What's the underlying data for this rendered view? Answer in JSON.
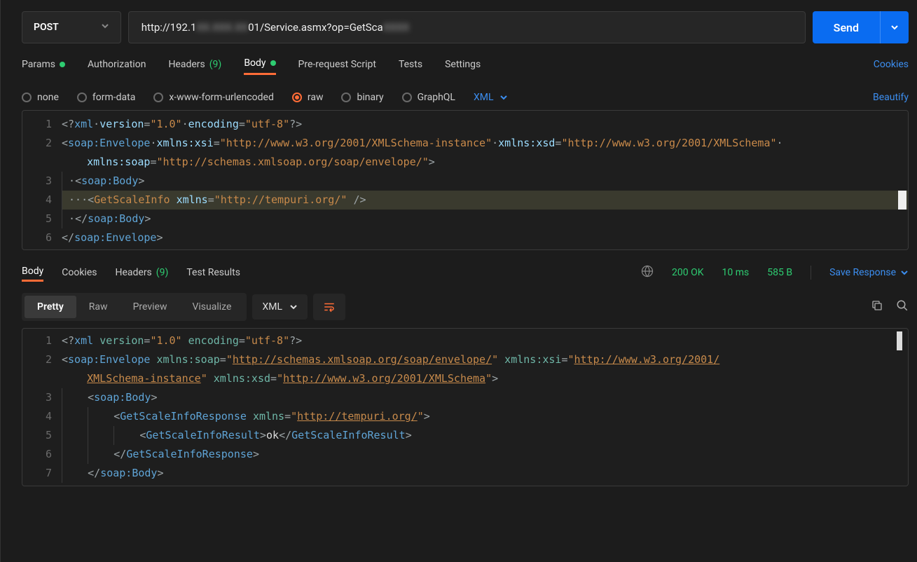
{
  "request": {
    "method": "POST",
    "url_prefix": "http://192.1",
    "url_blur": "XX.XXX.XX",
    "url_mid": "01/Service.asmx?op=GetSca",
    "url_blur2": "XXXX"
  },
  "tabs": {
    "params": "Params",
    "authorization": "Authorization",
    "headers": "Headers",
    "headers_count": "(9)",
    "body": "Body",
    "prerequest": "Pre-request Script",
    "tests": "Tests",
    "settings": "Settings",
    "cookies": "Cookies"
  },
  "body_types": {
    "none": "none",
    "formdata": "form-data",
    "urlencoded": "x-www-form-urlencoded",
    "raw": "raw",
    "binary": "binary",
    "graphql": "GraphQL",
    "format": "XML",
    "beautify": "Beautify"
  },
  "request_code": {
    "l1_a": "<?",
    "l1_b": "xml",
    "l1_c": "version",
    "l1_d": "\"1.0\"",
    "l1_e": "encoding",
    "l1_f": "\"utf-8\"",
    "l1_g": "?>",
    "l2_a": "<",
    "l2_b": "soap:Envelope",
    "l2_c": "xmlns:xsi",
    "l2_d": "\"http://www.w3.org/2001/XMLSchema-instance\"",
    "l2_e": "xmlns:xsd",
    "l2_f": "\"http://www.w3.org/2001/XMLSchema\"",
    "l2w_a": "xmlns:soap",
    "l2w_b": "\"http://schemas.xmlsoap.org/soap/envelope/\"",
    "l2w_c": ">",
    "l3_a": "<",
    "l3_b": "soap:Body",
    "l3_c": ">",
    "l4_a": "<",
    "l4_b": "GetScaleInfo",
    "l4_c": "xmlns",
    "l4_d": "\"http://tempuri.org/\"",
    "l4_e": "/>",
    "l5_a": "</",
    "l5_b": "soap:Body",
    "l5_c": ">",
    "l6_a": "</",
    "l6_b": "soap:Envelope",
    "l6_c": ">"
  },
  "response_tabs": {
    "body": "Body",
    "cookies": "Cookies",
    "headers": "Headers",
    "headers_count": "(9)",
    "testresults": "Test Results"
  },
  "response_meta": {
    "status_code": "200",
    "status_text": "OK",
    "time": "10 ms",
    "size": "585 B",
    "save": "Save Response"
  },
  "view_modes": {
    "pretty": "Pretty",
    "raw": "Raw",
    "preview": "Preview",
    "visualize": "Visualize",
    "format": "XML"
  },
  "response_code": {
    "l1_a": "<?",
    "l1_b": "xml",
    "l1_c": "version",
    "l1_d": "\"1.0\"",
    "l1_e": "encoding",
    "l1_f": "\"utf-8\"",
    "l1_g": "?>",
    "l2_a": "<",
    "l2_b": "soap:Envelope",
    "l2_c": "xmlns:soap",
    "l2_d": "http://schemas.xmlsoap.org/soap/envelope/",
    "l2_e": "xmlns:xsi",
    "l2_f": "http://www.w3.org/2001/",
    "l2w_a": "XMLSchema-instance",
    "l2w_b": "xmlns:xsd",
    "l2w_c": "http://www.w3.org/2001/XMLSchema",
    "l2w_d": ">",
    "l3_a": "<",
    "l3_b": "soap:Body",
    "l3_c": ">",
    "l4_a": "<",
    "l4_b": "GetScaleInfoResponse",
    "l4_c": "xmlns",
    "l4_d": "http://tempuri.org/",
    "l4_e": ">",
    "l5_a": "<",
    "l5_b": "GetScaleInfoResult",
    "l5_c": ">",
    "l5_tx": "ok",
    "l5_d": "</",
    "l5_e": "GetScaleInfoResult",
    "l5_f": ">",
    "l6_a": "</",
    "l6_b": "GetScaleInfoResponse",
    "l6_c": ">",
    "l7_a": "</",
    "l7_b": "soap:Body",
    "l7_c": ">"
  }
}
